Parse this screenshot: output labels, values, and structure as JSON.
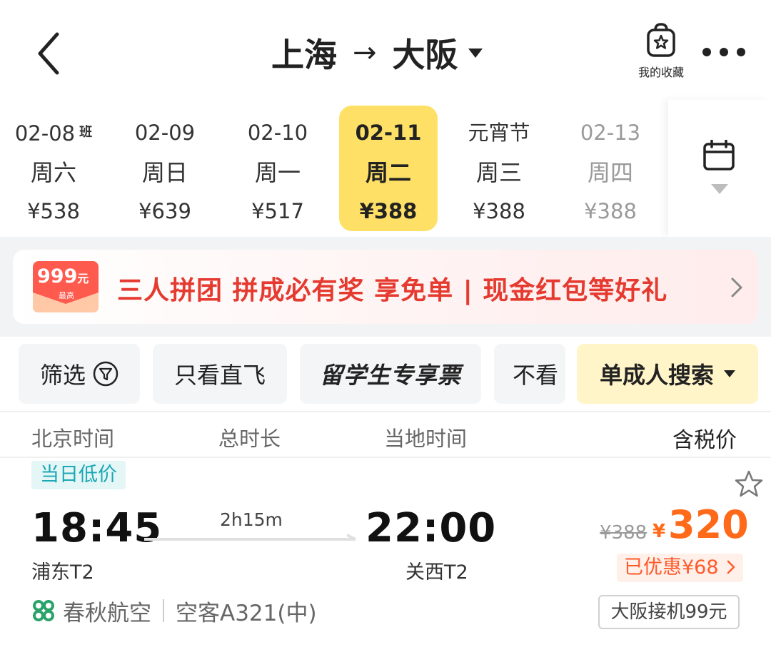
{
  "header": {
    "origin": "上海",
    "arrow": "→",
    "destination": "大阪",
    "favorites_label": "我的收藏"
  },
  "date_strip": {
    "dates": [
      {
        "date": "02-08",
        "badge": "班",
        "weekday": "周六",
        "price": "¥538",
        "state": "normal"
      },
      {
        "date": "02-09",
        "badge": "",
        "weekday": "周日",
        "price": "¥639",
        "state": "normal"
      },
      {
        "date": "02-10",
        "badge": "",
        "weekday": "周一",
        "price": "¥517",
        "state": "normal"
      },
      {
        "date": "02-11",
        "badge": "",
        "weekday": "周二",
        "price": "¥388",
        "state": "selected"
      },
      {
        "date": "元宵节",
        "badge": "",
        "weekday": "周三",
        "price": "¥388",
        "state": "normal"
      },
      {
        "date": "02-13",
        "badge": "",
        "weekday": "周四",
        "price": "¥388",
        "state": "partially-visible"
      }
    ]
  },
  "promo": {
    "badge_amount": "999",
    "badge_unit": "元",
    "badge_sub": "最高",
    "text": "三人拼团 拼成必有奖 享免单 | 现金红包等好礼"
  },
  "filters": {
    "filter_label": "筛选",
    "direct_label": "只看直飞",
    "student_label": "留学生专享票",
    "no_label": "不看 ",
    "solo_label": "单成人搜索"
  },
  "columns": {
    "beijing_time": "北京时间",
    "total_duration": "总时长",
    "local_time": "当地时间",
    "tax_price": "含税价"
  },
  "flight": {
    "tag": "当日低价",
    "departure_time": "18:45",
    "duration": "2h15m",
    "arrival_time": "22:00",
    "departure_airport": "浦东T2",
    "arrival_airport": "关西T2",
    "airline": "春秋航空",
    "aircraft": "空客A321(中)",
    "original_price": "¥388",
    "currency": "¥",
    "price": "320",
    "discount": "已优惠¥68",
    "pickup": "大阪接机99元"
  },
  "colors": {
    "accent_yellow": "#ffe066",
    "price_orange": "#ff6a1a",
    "promo_red": "#e53a2f",
    "tag_teal": "#19a8b4",
    "airline_green": "#2aa36b"
  }
}
